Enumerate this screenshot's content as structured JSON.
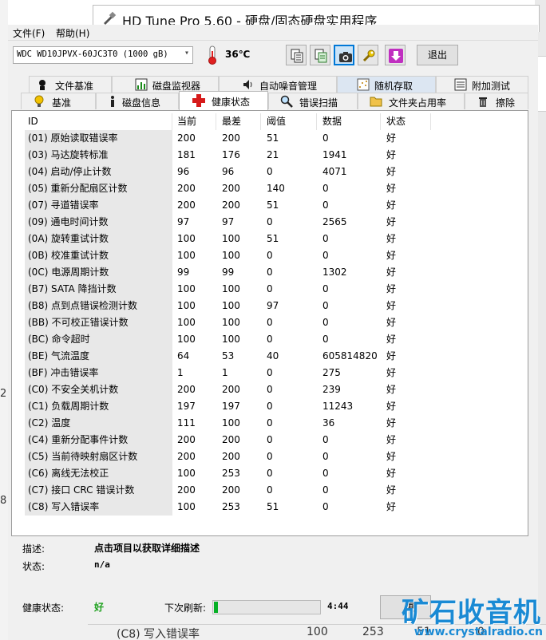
{
  "window": {
    "title": "HD Tune Pro 5.60 - 硬盘/固态硬盘实用程序"
  },
  "menu": {
    "file": "文件(F)",
    "help": "帮助(H)"
  },
  "toolbar": {
    "drive": "WDC WD10JPVX-60JC3T0 (1000 gB)",
    "temperature": "36℃",
    "exit": "退出"
  },
  "tabs_row1": [
    "文件基准",
    "磁盘监视器",
    "自动噪音管理",
    "随机存取",
    "附加测试"
  ],
  "tabs_row2": [
    "基准",
    "磁盘信息",
    "健康状态",
    "错误扫描",
    "文件夹占用率",
    "擦除"
  ],
  "columns": [
    "ID",
    "当前",
    "最差",
    "阈值",
    "数据",
    "状态"
  ],
  "rows": [
    [
      "(01) 原始读取错误率",
      "200",
      "200",
      "51",
      "0",
      "好"
    ],
    [
      "(03) 马达旋转标准",
      "181",
      "176",
      "21",
      "1941",
      "好"
    ],
    [
      "(04) 启动/停止计数",
      "96",
      "96",
      "0",
      "4071",
      "好"
    ],
    [
      "(05) 重新分配扇区计数",
      "200",
      "200",
      "140",
      "0",
      "好"
    ],
    [
      "(07) 寻道错误率",
      "200",
      "200",
      "51",
      "0",
      "好"
    ],
    [
      "(09) 通电时间计数",
      "97",
      "97",
      "0",
      "2565",
      "好"
    ],
    [
      "(0A) 旋转重试计数",
      "100",
      "100",
      "51",
      "0",
      "好"
    ],
    [
      "(0B) 校准重试计数",
      "100",
      "100",
      "0",
      "0",
      "好"
    ],
    [
      "(0C) 电源周期计数",
      "99",
      "99",
      "0",
      "1302",
      "好"
    ],
    [
      "(B7) SATA 降挡计数",
      "100",
      "100",
      "0",
      "0",
      "好"
    ],
    [
      "(B8) 点到点错误检测计数",
      "100",
      "100",
      "97",
      "0",
      "好"
    ],
    [
      "(BB) 不可校正错误计数",
      "100",
      "100",
      "0",
      "0",
      "好"
    ],
    [
      "(BC) 命令超时",
      "100",
      "100",
      "0",
      "0",
      "好"
    ],
    [
      "(BE) 气流温度",
      "64",
      "53",
      "40",
      "605814820",
      "好"
    ],
    [
      "(BF) 冲击错误率",
      "1",
      "1",
      "0",
      "275",
      "好"
    ],
    [
      "(C0) 不安全关机计数",
      "200",
      "200",
      "0",
      "239",
      "好"
    ],
    [
      "(C1) 负载周期计数",
      "197",
      "197",
      "0",
      "11243",
      "好"
    ],
    [
      "(C2) 温度",
      "111",
      "100",
      "0",
      "36",
      "好"
    ],
    [
      "(C4) 重新分配事件计数",
      "200",
      "200",
      "0",
      "0",
      "好"
    ],
    [
      "(C5) 当前待映射扇区计数",
      "200",
      "200",
      "0",
      "0",
      "好"
    ],
    [
      "(C6) 离线无法校正",
      "100",
      "253",
      "0",
      "0",
      "好"
    ],
    [
      "(C7) 接口 CRC 错误计数",
      "200",
      "200",
      "0",
      "0",
      "好"
    ],
    [
      "(C8) 写入错误率",
      "100",
      "253",
      "51",
      "0",
      "好"
    ]
  ],
  "info": {
    "desc_label": "描述:",
    "desc_value": "点击项目以获取详细描述",
    "status_label": "状态:",
    "status_value": "n/a"
  },
  "footer": {
    "health_label": "健康状态:",
    "health_value": "好",
    "refresh_label": "下次刷新:",
    "refresh_progress": 0.04,
    "timer": "4:44",
    "update_label": "更"
  },
  "watermark": {
    "cn": "矿石收音机",
    "url": "www.crystalradio.cn"
  },
  "background": {
    "bottom_fragments": [
      "(C8) 写入错误率",
      "100",
      "253",
      "51",
      "0"
    ],
    "left_fragments": [
      "2",
      "8"
    ]
  },
  "colors": {
    "health_good": "#1fa11f",
    "progress": "#06b025",
    "tab_highlight": "#dce6f2",
    "watermark": "#1a8ad4"
  }
}
